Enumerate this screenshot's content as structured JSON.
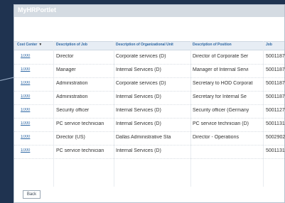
{
  "window": {
    "title": "MyHRPortlet"
  },
  "table": {
    "columns": [
      "Cost Center",
      "Description of Job",
      "Description of Organizational Unit",
      "Description of Position",
      "Job"
    ],
    "rows": [
      {
        "cost_center": "1000",
        "job_desc": "Director",
        "org_unit": "Corporate services (D)",
        "position": "Director of Corporate Ser",
        "job": "5001187"
      },
      {
        "cost_center": "1000",
        "job_desc": "Manager",
        "org_unit": "Internal Services (D)",
        "position": "Manager of Internal Servi",
        "job": "5001187"
      },
      {
        "cost_center": "1000",
        "job_desc": "Administration",
        "org_unit": "Corporate services (D)",
        "position": "Secretary to HOD Corporat",
        "job": "5001187"
      },
      {
        "cost_center": "1000",
        "job_desc": "Administration",
        "org_unit": "Internal Services (D)",
        "position": "Secretary for Internal Se",
        "job": "5001187"
      },
      {
        "cost_center": "1000",
        "job_desc": "Security officer",
        "org_unit": "Internal Services (D)",
        "position": "Security officer (Germany",
        "job": "5001127"
      },
      {
        "cost_center": "1000",
        "job_desc": "PC service technician",
        "org_unit": "Internal Services (D)",
        "position": "PC service technician (D)",
        "job": "5001131"
      },
      {
        "cost_center": "1000",
        "job_desc": "Director (US)",
        "org_unit": "Dallas Administrative Sta",
        "position": "Director - Operations",
        "job": "5002902"
      },
      {
        "cost_center": "1000",
        "job_desc": "PC service technician",
        "org_unit": "Internal Services (D)",
        "position": "",
        "job": "5001131"
      }
    ]
  },
  "footer": {
    "back_label": "Back"
  }
}
